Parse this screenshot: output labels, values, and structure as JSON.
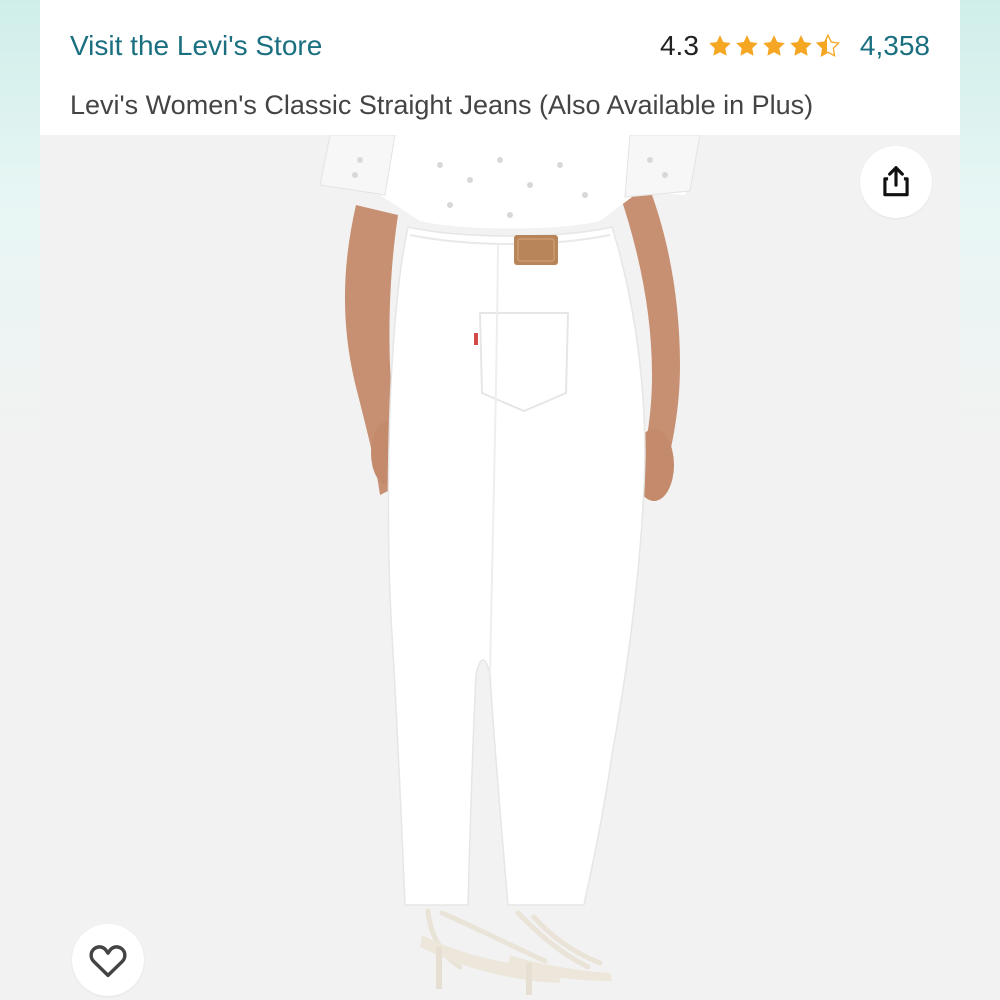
{
  "header": {
    "store_link": "Visit the Levi's Store",
    "rating_value": "4.3",
    "rating": 4.3,
    "review_count": "4,358",
    "product_title": "Levi's Women's Classic Straight Jeans (Also Available in Plus)"
  },
  "image": {
    "alt": "Woman wearing white straight jeans, back view"
  },
  "icons": {
    "share": "share-icon",
    "favorite": "heart-icon",
    "star": "star-icon"
  },
  "colors": {
    "link": "#1a6f80",
    "star": "#f5a623",
    "background": "#f1f1f1"
  }
}
